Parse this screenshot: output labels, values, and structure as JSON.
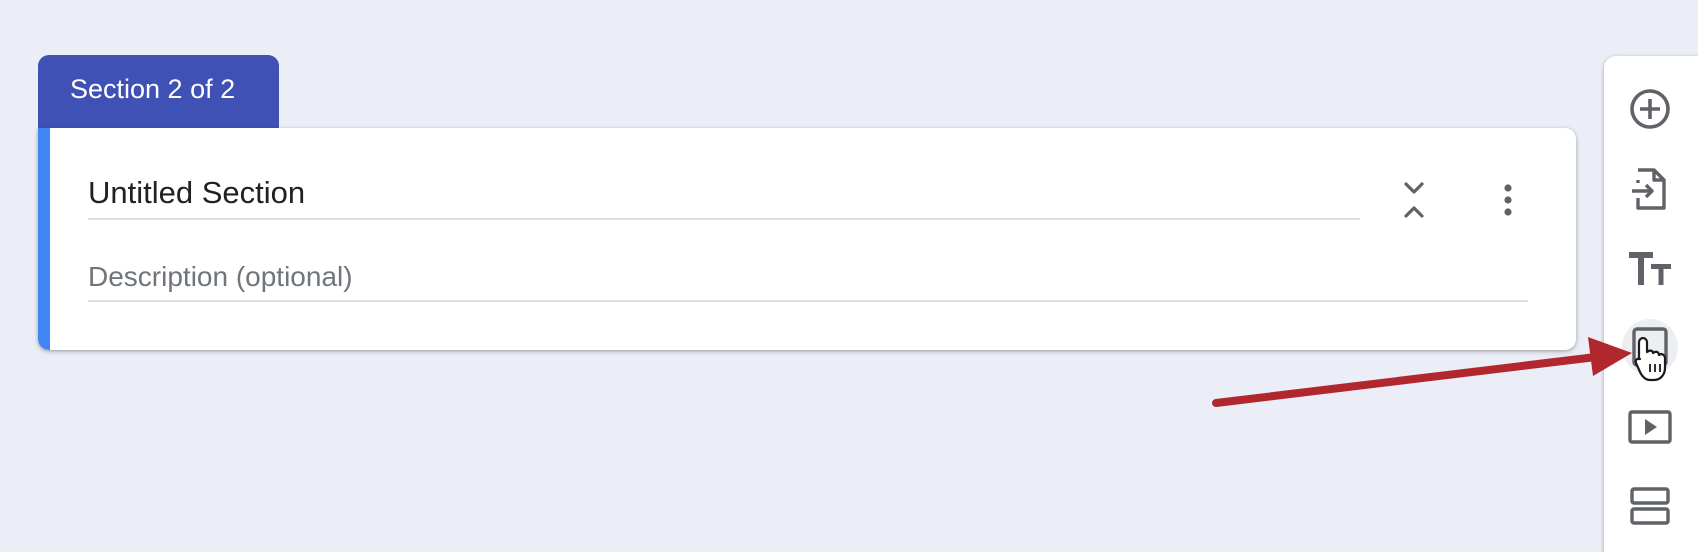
{
  "section": {
    "tab_label": "Section 2 of 2",
    "title": "Untitled Section",
    "description_placeholder": "Description (optional)"
  },
  "toolbar": {
    "items": [
      {
        "icon": "add-circle-icon"
      },
      {
        "icon": "import-questions-icon"
      },
      {
        "icon": "title-text-icon"
      },
      {
        "icon": "image-icon"
      },
      {
        "icon": "video-icon"
      },
      {
        "icon": "section-icon"
      }
    ]
  },
  "colors": {
    "background": "#ebedf7",
    "tab": "#3f51b5",
    "accent": "#4285f4",
    "icon": "#5f6368",
    "arrow": "#b0282e"
  }
}
